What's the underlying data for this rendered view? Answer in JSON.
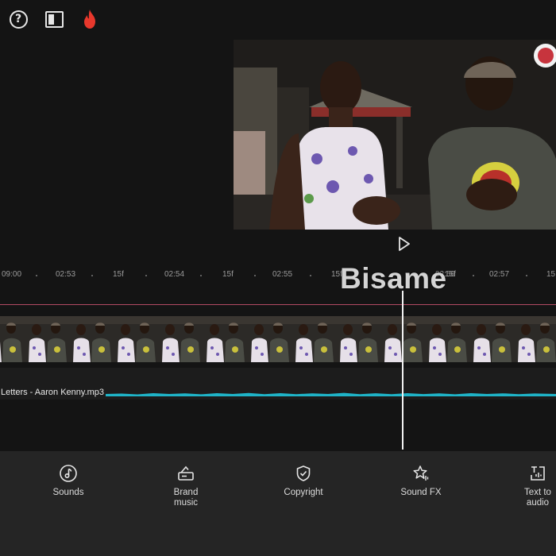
{
  "topbar": {
    "help_icon": "question-circle-icon",
    "layout_icon": "layout-panel-icon",
    "flame_icon": "flame-icon",
    "flame_color": "#e8382c"
  },
  "preview": {
    "play_icon": "play-icon"
  },
  "ruler": {
    "ticks": [
      "09:00",
      "02:53",
      "15f",
      "02:54",
      "15f",
      "02:55",
      "15f",
      "02:56",
      "15f",
      "02:57",
      "15"
    ]
  },
  "caption": {
    "text": "Bisame"
  },
  "audio": {
    "label": "Letters - Aaron Kenny.mp3",
    "wave_color": "#1fb4c8"
  },
  "toolbar": {
    "items": [
      {
        "label": "Sounds",
        "icon": "music-note-icon"
      },
      {
        "label": "Brand\nmusic",
        "icon": "brand-music-icon"
      },
      {
        "label": "Copyright",
        "icon": "shield-check-icon"
      },
      {
        "label": "Sound FX",
        "icon": "sparkle-star-icon"
      },
      {
        "label": "Text to\naudio",
        "icon": "text-to-audio-icon"
      }
    ]
  },
  "colors": {
    "background": "#141414",
    "toolbar_bg": "#252525",
    "timeline_marker": "#b24a63"
  }
}
